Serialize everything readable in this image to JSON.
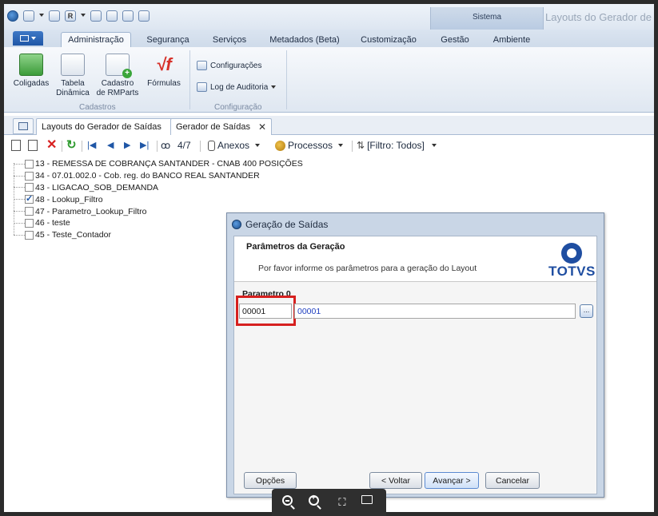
{
  "window": {
    "title": "Layouts do Gerador de S",
    "context_group": "Sistema"
  },
  "ribbon_tabs": [
    {
      "label": "Administração",
      "active": true
    },
    {
      "label": "Segurança"
    },
    {
      "label": "Serviços"
    },
    {
      "label": "Metadados (Beta)"
    },
    {
      "label": "Customização"
    },
    {
      "label": "Gestão"
    },
    {
      "label": "Ambiente"
    }
  ],
  "ribbon": {
    "cadastros": {
      "group_label": "Cadastros",
      "coligadas": "Coligadas",
      "tabela_1": "Tabela",
      "tabela_2": "Dinâmica",
      "cadastro_1": "Cadastro",
      "cadastro_2": "de RMParts",
      "formulas": "Fórmulas"
    },
    "configuracao": {
      "group_label": "Configuração",
      "configuracoes": "Configurações",
      "log_auditoria": "Log de Auditoria"
    }
  },
  "doc_tabs": [
    {
      "label": "Layouts do Gerador de Saídas",
      "close": "✕"
    },
    {
      "label": "Gerador de Saídas",
      "close": "✕"
    }
  ],
  "toolbar": {
    "record_count": "4/7",
    "anexos": "Anexos",
    "processos": "Processos",
    "filtro": "[Filtro: Todos]"
  },
  "tree": [
    {
      "label": "13 - REMESSA DE COBRANÇA SANTANDER - CNAB 400 POSIÇÕES",
      "checked": false
    },
    {
      "label": "34 - 07.01.002.0 - Cob. reg. do BANCO REAL SANTANDER",
      "checked": false
    },
    {
      "label": "43 - LIGACAO_SOB_DEMANDA",
      "checked": false
    },
    {
      "label": "48 - Lookup_Filtro",
      "checked": true
    },
    {
      "label": "47 - Parametro_Lookup_Filtro",
      "checked": false
    },
    {
      "label": "46 - teste",
      "checked": false
    },
    {
      "label": "45 - Teste_Contador",
      "checked": false
    }
  ],
  "dialog": {
    "title": "Geração de Saídas",
    "header_title": "Parâmetros da Geração",
    "header_subtitle": "Por favor informe os parâmetros para a geração do Layout",
    "logo_text": "TOTVS",
    "param_label": "Parametro 0",
    "param_code": "00001",
    "param_description": "00001",
    "lookup_label": "...",
    "buttons": {
      "opcoes": "Opções",
      "voltar": "< Voltar",
      "avancar": "Avançar >",
      "cancelar": "Cancelar"
    }
  },
  "colors": {
    "accent": "#1f56a6",
    "highlight": "#d6201f",
    "totvs_blue": "#1f4ea1"
  },
  "icons": [
    "app-logo-icon",
    "new-icon",
    "edit-icon",
    "delete-icon",
    "refresh-icon",
    "first-icon",
    "prev-icon",
    "next-icon",
    "last-icon",
    "binoculars-icon",
    "attachment-icon",
    "process-icon",
    "filter-icon",
    "zoom-out-icon",
    "zoom-in-icon",
    "fullscreen-icon",
    "present-icon"
  ]
}
